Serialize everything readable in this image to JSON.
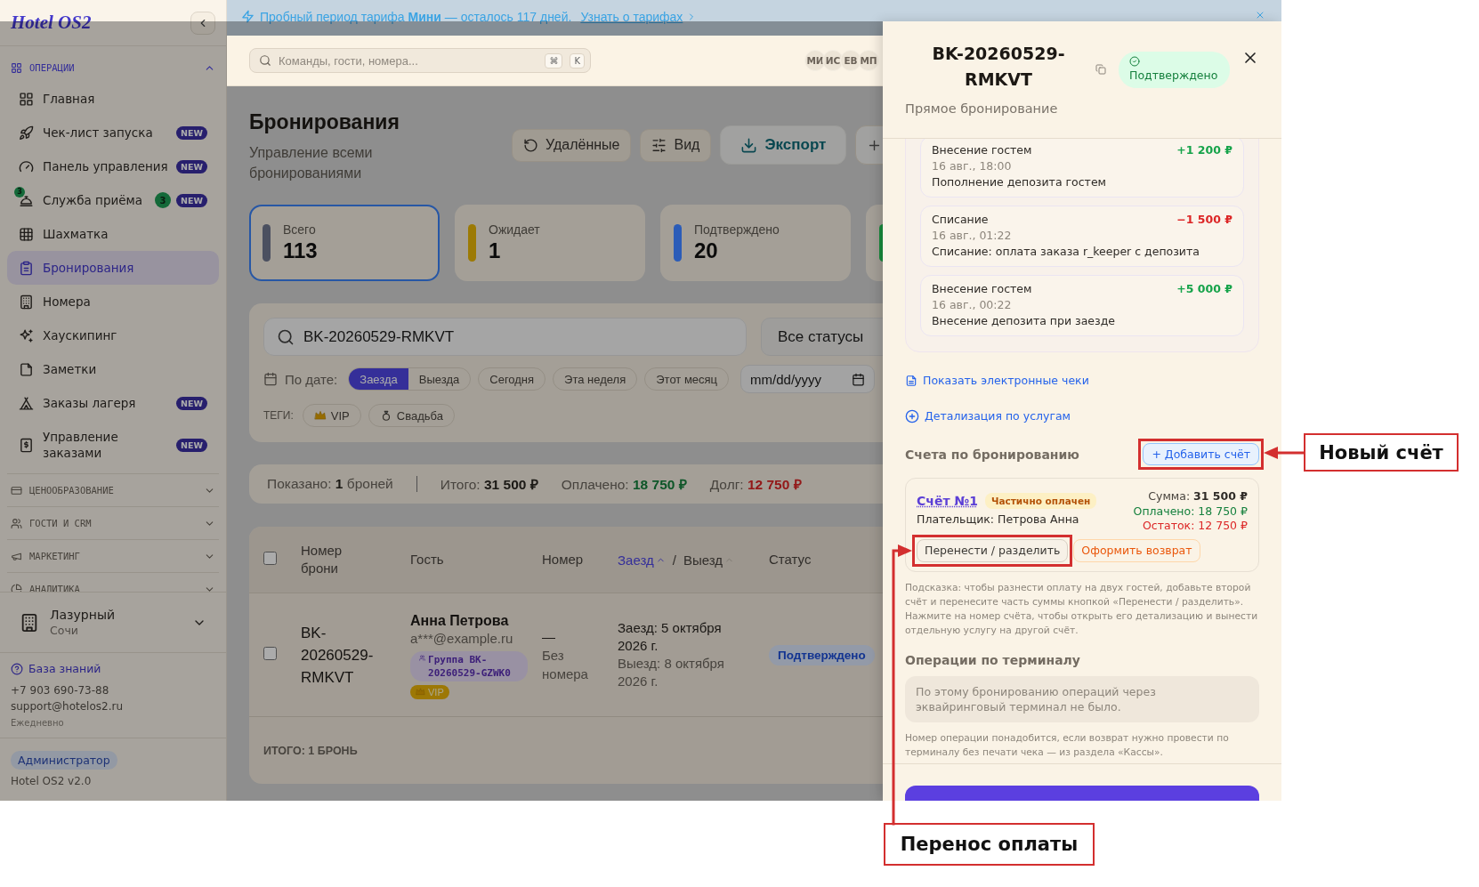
{
  "trial_banner": {
    "text": "Пробный период тарифа **Мини** — осталось 117 дней.",
    "link": "Узнать о тарифах"
  },
  "sidebar": {
    "logo": "Hotel OS2",
    "sections": [
      {
        "title": "ОПЕРАЦИИ",
        "expanded": true,
        "items": [
          {
            "label": "Главная",
            "selected": false
          },
          {
            "label": "Чек-лист запуска",
            "badge": "NEW",
            "selected": false
          },
          {
            "label": "Панель управления",
            "badge": "NEW",
            "selected": false
          },
          {
            "label": "Служба приёма",
            "icon_badge": "3",
            "count": "3",
            "badge": "NEW",
            "selected": false
          },
          {
            "label": "Шахматка",
            "selected": false
          },
          {
            "label": "Бронирования",
            "selected": true
          },
          {
            "label": "Номера",
            "selected": false
          },
          {
            "label": "Хаускипинг",
            "selected": false
          },
          {
            "label": "Заметки",
            "selected": false
          },
          {
            "label": "Заказы лагеря",
            "badge": "NEW",
            "selected": false
          },
          {
            "label": "Управление заказами",
            "badge": "NEW",
            "selected": false
          }
        ]
      },
      {
        "title": "ЦЕНООБРАЗОВАНИЕ",
        "expanded": false
      },
      {
        "title": "ГОСТИ И CRM",
        "expanded": false
      },
      {
        "title": "МАРКЕТИНГ",
        "expanded": false
      },
      {
        "title": "АНАЛИТИКА",
        "expanded": false
      }
    ],
    "property": {
      "name": "Лазурный",
      "city": "Сочи"
    },
    "help": {
      "link": "База знаний",
      "phone": "+7 903 690-73-88",
      "email": "support@hotelos2.ru",
      "hours": "Ежедневно"
    },
    "role": "Администратор",
    "version": "Hotel OS2 v2.0"
  },
  "header": {
    "search": {
      "placeholder": "Команды, гости, номера..."
    },
    "shortcut": [
      "⌘",
      "K"
    ],
    "avatars": [
      "МИ",
      "ИС",
      "ЕВ",
      "МП"
    ]
  },
  "page": {
    "title": "Бронирования",
    "subtitle": "Управление всеми бронированиями",
    "actions": [
      {
        "kind": "restore",
        "label": "Удалённые"
      },
      {
        "kind": "view",
        "label": "Вид"
      },
      {
        "kind": "export",
        "label": "Экспорт"
      },
      {
        "kind": "add"
      }
    ]
  },
  "stats": [
    {
      "label": "Всего",
      "value": "113",
      "color": "#4b5060",
      "selected": true
    },
    {
      "label": "Ожидает",
      "value": "1",
      "color": "#9c7a05",
      "selected": false
    },
    {
      "label": "Подтверждено",
      "value": "20",
      "color": "#2b5cb8",
      "selected": false
    },
    {
      "color": "#178a3c",
      "selected": false
    }
  ],
  "filters": {
    "search": {
      "value": "BK-20260529-RMKVT"
    },
    "status": "Все статусы",
    "date_label": "По дате:",
    "date_modes": [
      {
        "label": "Заезда",
        "selected": true
      },
      {
        "label": "Выезда",
        "selected": false
      }
    ],
    "ranges": [
      {
        "label": "Сегодня",
        "selected": false
      },
      {
        "label": "Эта неделя",
        "selected": false
      },
      {
        "label": "Этот месяц",
        "selected": false
      }
    ],
    "date": {
      "placeholder": "mm/dd/yyyy"
    },
    "tags_label": "ТЕГИ:",
    "tags": [
      {
        "kind": "vip",
        "label": "VIP",
        "selected": false
      },
      {
        "kind": "wedding",
        "label": "Свадьба",
        "selected": false
      }
    ]
  },
  "summary": [
    {
      "kind": "count",
      "label": "Показано:",
      "value": "1",
      "suffix": "броней"
    },
    {
      "kind": "total",
      "label": "Итого:",
      "value": "31 500 ₽"
    },
    {
      "kind": "paid",
      "label": "Оплачено:",
      "value": "18 750 ₽"
    },
    {
      "kind": "debt",
      "label": "Долг:",
      "value": "12 750 ₽"
    }
  ],
  "table": {
    "select_all": {
      "checked": false
    },
    "columns": [
      {
        "label": "Номер брони"
      },
      {
        "label": "Гость"
      },
      {
        "label": "Номер"
      },
      {
        "kind": "sort_pair",
        "sorts": [
          {
            "label": "Заезд",
            "active": true
          },
          {
            "label": "Выезд",
            "active": false
          }
        ],
        "separator": "/"
      },
      {
        "label": "Статус"
      }
    ],
    "rows": [
      {
        "checked": false,
        "booking": "BK-20260529-RMKVT",
        "guest": "Анна Петрова",
        "email": "a***@example.ru",
        "group": "Группа BK-20260529-GZWK0",
        "tag": "VIP",
        "room": "—",
        "room_note": "Без номера",
        "checkin": "Заезд: 5 октября 2026 г.",
        "checkout": "Выезд: 8 октября 2026 г.",
        "status": "Подтверждено"
      }
    ],
    "footer": "ИТОГО: 1 БРОНЬ"
  },
  "drawer": {
    "title": "BK-20260529-RMKVT",
    "status": "Подтверждено",
    "subtitle": "Прямое бронирование",
    "ledger": [
      {
        "kind": "credit",
        "title": "Внесение гостем",
        "amount": "+1 200 ₽",
        "date": "16 авг., 18:00",
        "note": "Пополнение депозита гостем"
      },
      {
        "kind": "debit",
        "title": "Списание",
        "amount": "−1 500 ₽",
        "date": "16 авг., 01:22",
        "note": "Списание: оплата заказа r_keeper с депозита"
      },
      {
        "kind": "credit",
        "title": "Внесение гостем",
        "amount": "+5 000 ₽",
        "date": "16 авг., 00:22",
        "note": "Внесение депозита при заезде"
      }
    ],
    "links": [
      {
        "kind": "receipts",
        "label": "Показать электронные чеки"
      },
      {
        "kind": "details",
        "label": "Детализация по услугам"
      }
    ],
    "invoices_title": "Счета по бронированию",
    "add_invoice": "+ Добавить счёт",
    "invoices": [
      {
        "number": "Счёт №1",
        "status": "Частично оплачен",
        "payer": "Плательщик: Петрова Анна",
        "sum": "Сумма: **31 500 ₽**",
        "paid": "Оплачено: 18 750 ₽",
        "rest": "Остаток: 12 750 ₽",
        "actions": [
          {
            "kind": "transfer",
            "label": "Перенести / разделить"
          },
          {
            "kind": "refund",
            "label": "Оформить возврат"
          }
        ]
      }
    ],
    "hint": "Подсказка: чтобы разнести оплату на двух гостей, добавьте второй счёт и перенесите часть суммы кнопкой «Перенести / разделить». Нажмите на номер счёта, чтобы открыть его детализацию и вынести отдельную услугу на другой счёт.",
    "terminal_title": "Операции по терминалу",
    "terminal_empty": "По этому бронированию операций через эквайринговый терминал не было.",
    "terminal_note": "Номер операции понадобится, если возврат нужно провести по терминалу без печати чека — из раздела «Кассы»."
  },
  "annotations": [
    {
      "text": "Новый счёт"
    },
    {
      "text": "Перенос оплаты"
    }
  ]
}
